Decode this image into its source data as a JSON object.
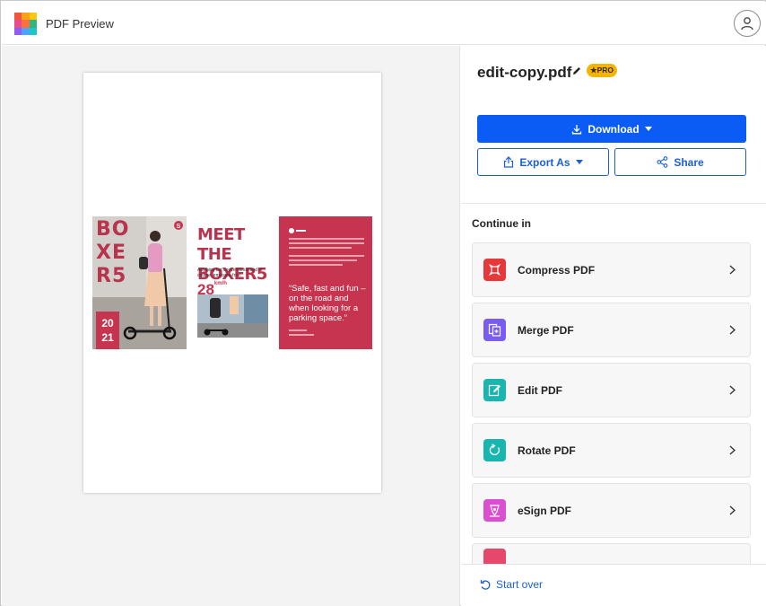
{
  "app": {
    "title": "PDF Preview",
    "logo_colors": [
      "#f2543d",
      "#f7a21b",
      "#f9c80e",
      "#e84c8b",
      "#ff6f3c",
      "#2fb67c",
      "#8e5cf7",
      "#4aa3ff",
      "#1dc6c6"
    ]
  },
  "file": {
    "name": "edit-copy.pdf",
    "badge": "PRO"
  },
  "actions": {
    "download_label": "Download",
    "export_label": "Export As",
    "share_label": "Share"
  },
  "continue_in": {
    "heading": "Continue in",
    "tools": [
      {
        "label": "Compress PDF",
        "icon": "compress-icon",
        "color": "#e5383b"
      },
      {
        "label": "Merge PDF",
        "icon": "merge-icon",
        "color": "#7b5cf0"
      },
      {
        "label": "Edit PDF",
        "icon": "edit-icon",
        "color": "#19b6b0"
      },
      {
        "label": "Rotate PDF",
        "icon": "rotate-icon",
        "color": "#19b6b0"
      },
      {
        "label": "eSign PDF",
        "icon": "esign-icon",
        "color": "#d94fd0"
      },
      {
        "label": "",
        "icon": "tool-icon",
        "color": "#e5486a"
      }
    ]
  },
  "footer": {
    "start_over_label": "Start over"
  },
  "document_preview": {
    "left_panel": {
      "vertical_title": "BO\nXE\nR5",
      "year": "20\n21"
    },
    "middle_panel": {
      "title_line1": "MEET THE",
      "title_line2": "BOXER5",
      "subtitle": "Anything but conventional and of course, emission-free.",
      "speed_value": "28",
      "speed_unit": "km/h"
    },
    "right_panel": {
      "quote": "“Safe, fast and fun – on the road and when looking for a parking space.”"
    }
  },
  "colors": {
    "accent_blue": "#0a5cf5",
    "brand_red": "#c7344f",
    "pro_yellow": "#f5b400"
  }
}
